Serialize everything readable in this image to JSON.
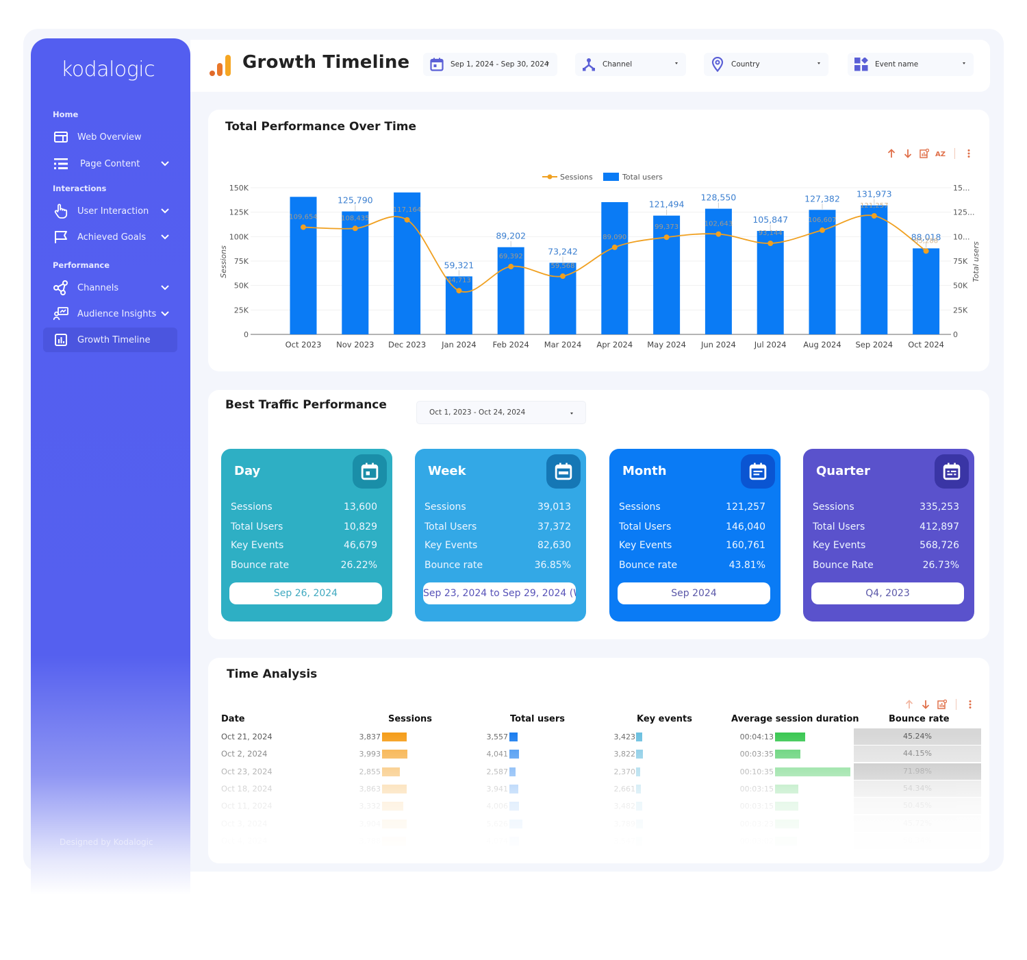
{
  "sidebar": {
    "logo": "kodalogic",
    "sections": {
      "home": "Home",
      "interactions": "Interactions",
      "performance": "Performance"
    },
    "items": [
      {
        "label": "Web Overview",
        "icon": "layout-icon",
        "expandable": false
      },
      {
        "label": "Page Content",
        "icon": "list-icon",
        "expandable": true
      },
      {
        "label": "User Interaction",
        "icon": "hand-pointer-icon",
        "expandable": true
      },
      {
        "label": "Achieved Goals",
        "icon": "flag-icon",
        "expandable": true
      },
      {
        "label": "Channels",
        "icon": "share-nodes-icon",
        "expandable": true
      },
      {
        "label": "Audience Insights",
        "icon": "presentation-user-icon",
        "expandable": true
      },
      {
        "label": "Growth Timeline",
        "icon": "bar-chart-icon",
        "expandable": false,
        "active": true
      }
    ],
    "footer": "Designed by Kodalogic"
  },
  "header": {
    "title": "Growth Timeline",
    "filters": [
      {
        "label": "Sep 1, 2024 - Sep 30, 2024",
        "icon": "calendar-icon"
      },
      {
        "label": "Channel",
        "icon": "channel-icon"
      },
      {
        "label": "Country",
        "icon": "location-pin-icon"
      },
      {
        "label": "Event name",
        "icon": "widgets-icon"
      }
    ]
  },
  "performance_panel": {
    "title": "Total Performance Over Time",
    "toolbar": [
      "sort-ascending-icon",
      "sort-descending-icon",
      "chart-settings-icon",
      "sort-az-icon",
      "more-vert-icon"
    ]
  },
  "chart_data": {
    "type": "bar",
    "title": "Total Performance Over Time",
    "categories": [
      "Oct 2023",
      "Nov 2023",
      "Dec 2023",
      "Jan 2024",
      "Feb 2024",
      "Mar 2024",
      "Apr 2024",
      "May 2024",
      "Jun 2024",
      "Jul 2024",
      "Aug 2024",
      "Sep 2024",
      "Oct 2024"
    ],
    "series": [
      {
        "name": "Total users",
        "type": "bar",
        "axis": "right",
        "color": "#0a7bf5",
        "values": [
          140700,
          125790,
          145200,
          59321,
          89202,
          73242,
          135300,
          121494,
          128550,
          105847,
          127382,
          131973,
          88018
        ]
      },
      {
        "name": "Sessions",
        "type": "line",
        "axis": "left",
        "color": "#f0a020",
        "values": [
          109654,
          108435,
          117164,
          44713,
          69392,
          59568,
          89090,
          99373,
          102643,
          93144,
          106607,
          121257,
          85288
        ]
      }
    ],
    "bar_labels": [
      "",
      "125,790",
      "",
      "59,321",
      "89,202",
      "73,242",
      "",
      "121,494",
      "128,550",
      "105,847",
      "127,382",
      "131,973",
      "88,018"
    ],
    "line_labels": [
      "109,654",
      "108,435",
      "117,164",
      "44,713",
      "69,392",
      "59,568",
      "89,090",
      "99,373",
      "102,643",
      "93,144",
      "106,607",
      "121,257",
      "85,288"
    ],
    "ylabel": "Sessions",
    "y2label": "Total users",
    "ylim": [
      0,
      150000
    ],
    "yticks": [
      "0",
      "25K",
      "50K",
      "75K",
      "100K",
      "125K",
      "150K"
    ],
    "y2ticks": [
      "0",
      "25K",
      "50K",
      "75K",
      "10...",
      "125...",
      "15..."
    ],
    "legend": [
      "Sessions",
      "Total users"
    ],
    "legend_position": "top-center",
    "grid": true
  },
  "best_traffic": {
    "title": "Best Traffic Performance",
    "date_range": "Oct 1, 2023 - Oct 24, 2024",
    "cards": [
      {
        "title": "Day",
        "icon": "calendar-day-icon",
        "color": "#2eafc4",
        "icon_bg": "#1a8ea8",
        "pill_color": "#40a9c0",
        "rows": [
          {
            "label": "Sessions",
            "value": "13,600"
          },
          {
            "label": "Total Users",
            "value": "10,829"
          },
          {
            "label": "Key Events",
            "value": "46,679"
          },
          {
            "label": "Bounce rate",
            "value": "26.22%"
          }
        ],
        "period": "Sep 26, 2024"
      },
      {
        "title": "Week",
        "icon": "calendar-week-icon",
        "color": "#33a8e6",
        "icon_bg": "#1577b5",
        "pill_color": "#5752b8",
        "rows": [
          {
            "label": "Sessions",
            "value": "39,013"
          },
          {
            "label": "Total Users",
            "value": "37,372"
          },
          {
            "label": "Key Events",
            "value": "82,630"
          },
          {
            "label": "Bounce rate",
            "value": "36.85%"
          }
        ],
        "period": "Sep 23, 2024 to Sep 29, 2024 (W..."
      },
      {
        "title": "Month",
        "icon": "calendar-month-icon",
        "color": "#0a7bf5",
        "icon_bg": "#0a55d2",
        "pill_color": "#5a57a8",
        "rows": [
          {
            "label": "Sessions",
            "value": "121,257"
          },
          {
            "label": "Total Users",
            "value": "146,040"
          },
          {
            "label": "Key Events",
            "value": "160,761"
          },
          {
            "label": "Bounce rate",
            "value": "43.81%"
          }
        ],
        "period": "Sep 2024"
      },
      {
        "title": "Quarter",
        "icon": "calendar-quarter-icon",
        "color": "#5a52cc",
        "icon_bg": "#3a35a5",
        "pill_color": "#5a57a8",
        "rows": [
          {
            "label": "Sessions",
            "value": "335,253"
          },
          {
            "label": "Total Users",
            "value": "412,897"
          },
          {
            "label": "Key Events",
            "value": "568,726"
          },
          {
            "label": "Bounce Rate",
            "value": "26.73%"
          }
        ],
        "period": "Q4, 2023"
      }
    ]
  },
  "time_analysis": {
    "title": "Time Analysis",
    "toolbar": [
      "sort-ascending-icon",
      "sort-descending-icon",
      "chart-settings-icon",
      "more-vert-icon"
    ],
    "columns": [
      "Date",
      "Sessions",
      "Total users",
      "Key events",
      "Average session duration",
      "Bounce rate"
    ],
    "rows": [
      {
        "date": "Oct 21, 2024",
        "sessions": "3,837",
        "sessions_v": 3837,
        "users": "3,557",
        "users_v": 3557,
        "events": "3,423",
        "events_v": 3423,
        "duration": "00:04:13",
        "duration_s": 253,
        "bounce": "45.24%",
        "bounce_v": 45.24
      },
      {
        "date": "Oct 2, 2024",
        "sessions": "3,993",
        "sessions_v": 3993,
        "users": "4,041",
        "users_v": 4041,
        "events": "3,822",
        "events_v": 3822,
        "duration": "00:03:35",
        "duration_s": 215,
        "bounce": "44.15%",
        "bounce_v": 44.15
      },
      {
        "date": "Oct 23, 2024",
        "sessions": "2,855",
        "sessions_v": 2855,
        "users": "2,587",
        "users_v": 2587,
        "events": "2,370",
        "events_v": 2370,
        "duration": "00:10:35",
        "duration_s": 635,
        "bounce": "71.98%",
        "bounce_v": 71.98
      },
      {
        "date": "Oct 18, 2024",
        "sessions": "3,863",
        "sessions_v": 3863,
        "users": "3,941",
        "users_v": 3941,
        "events": "2,661",
        "events_v": 2661,
        "duration": "00:03:15",
        "duration_s": 195,
        "bounce": "54.34%",
        "bounce_v": 54.34
      },
      {
        "date": "Oct 11, 2024",
        "sessions": "3,332",
        "sessions_v": 3332,
        "users": "4,006",
        "users_v": 4006,
        "events": "3,482",
        "events_v": 3482,
        "duration": "00:03:15",
        "duration_s": 195,
        "bounce": "50.45%",
        "bounce_v": 50.45
      },
      {
        "date": "Oct 3, 2024",
        "sessions": "3,904",
        "sessions_v": 3904,
        "users": "5,626",
        "users_v": 5626,
        "events": "3,789",
        "events_v": 3789,
        "duration": "00:03:23",
        "duration_s": 203,
        "bounce": "45.72%",
        "bounce_v": 45.72
      },
      {
        "date": "Oct 4, 2024",
        "sessions": "3,788",
        "sessions_v": 3788,
        "users": "4,074",
        "users_v": 4074,
        "events": "3,547",
        "events_v": 3547,
        "duration": "00:03:02",
        "duration_s": 182,
        "bounce": "50.34%",
        "bounce_v": 50.34
      }
    ],
    "colors": {
      "sessions": "#f59e1b",
      "users": "#1c7eef",
      "events": "#6cc0e0",
      "duration": "#3cc854",
      "bounce": "#b5b5b5"
    }
  }
}
